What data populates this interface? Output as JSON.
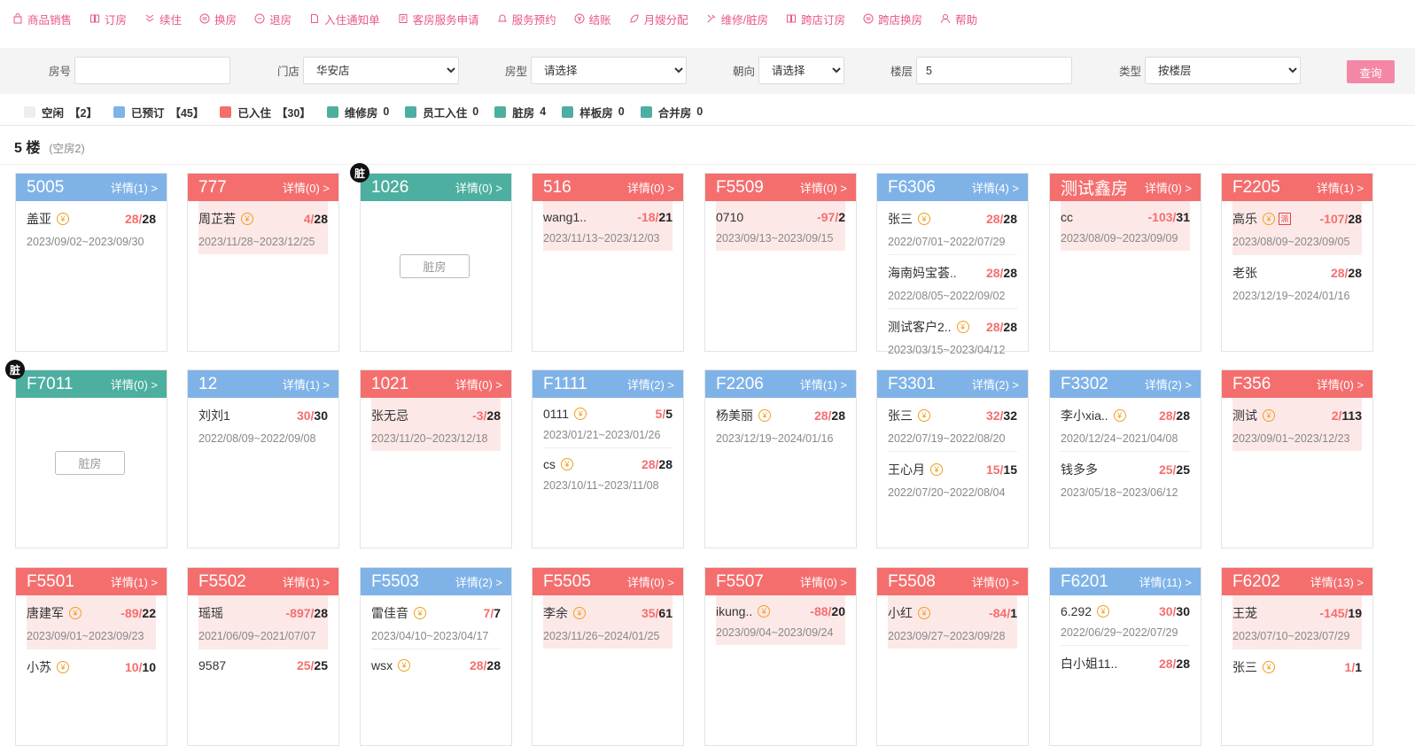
{
  "toolbar": [
    {
      "label": "商品销售",
      "icon": "bag-icon"
    },
    {
      "label": "订房",
      "icon": "book-icon"
    },
    {
      "label": "续住",
      "icon": "chevrons-down-icon"
    },
    {
      "label": "换房",
      "icon": "circle-swap-icon"
    },
    {
      "label": "退房",
      "icon": "circle-exit-icon"
    },
    {
      "label": "入住通知单",
      "icon": "document-icon"
    },
    {
      "label": "客房服务申请",
      "icon": "form-icon"
    },
    {
      "label": "服务预约",
      "icon": "bell-icon"
    },
    {
      "label": "结账",
      "icon": "coin-icon"
    },
    {
      "label": "月嫂分配",
      "icon": "leaf-icon"
    },
    {
      "label": "维修/脏房",
      "icon": "tools-icon"
    },
    {
      "label": "跨店订房",
      "icon": "book-icon"
    },
    {
      "label": "跨店换房",
      "icon": "circle-swap-icon"
    },
    {
      "label": "帮助",
      "icon": "user-icon"
    }
  ],
  "filters": {
    "room_no": {
      "label": "房号",
      "value": ""
    },
    "store": {
      "label": "门店",
      "value": "华安店"
    },
    "room_type": {
      "label": "房型",
      "value": "请选择"
    },
    "orientation": {
      "label": "朝向",
      "value": "请选择"
    },
    "floor": {
      "label": "楼层",
      "value": "5"
    },
    "type": {
      "label": "类型",
      "value": "按楼层"
    },
    "query_label": "查询"
  },
  "legend": [
    {
      "label": "空闲",
      "count": "【2】",
      "color": "#eeeeee"
    },
    {
      "label": "已预订",
      "count": "【45】",
      "color": "#7fb3e8"
    },
    {
      "label": "已入住",
      "count": "【30】",
      "color": "#f56e6e"
    },
    {
      "label": "维修房",
      "count": "0",
      "color": "#4daf9f"
    },
    {
      "label": "员工入住",
      "count": "0",
      "color": "#4daf9f"
    },
    {
      "label": "脏房",
      "count": "4",
      "color": "#4daf9f"
    },
    {
      "label": "样板房",
      "count": "0",
      "color": "#4daf9f"
    },
    {
      "label": "合并房",
      "count": "0",
      "color": "#4daf9f"
    }
  ],
  "floor": {
    "label": "5 楼",
    "empty": "(空房2)"
  },
  "dirty_label": "脏房",
  "dirty_badge": "脏",
  "rooms": [
    {
      "no": "5005",
      "detail": "详情(1) >",
      "status": "blue",
      "guests": [
        {
          "name": "盖亚",
          "yen": true,
          "a": "28",
          "b": "28",
          "dates": "2023/09/02~2023/09/30",
          "pink": false
        }
      ]
    },
    {
      "no": "777",
      "detail": "详情(0) >",
      "status": "red",
      "guests": [
        {
          "name": "周芷若",
          "yen": true,
          "a": "4",
          "b": "28",
          "dates": "2023/11/28~2023/12/25",
          "pink": true
        }
      ]
    },
    {
      "no": "1026",
      "detail": "详情(0) >",
      "status": "teal",
      "dirty": true,
      "guests": []
    },
    {
      "no": "516",
      "detail": "详情(0) >",
      "status": "red",
      "guests": [
        {
          "name": "wang1..",
          "yen": false,
          "a": "-18",
          "b": "21",
          "dates": "2023/11/13~2023/12/03",
          "pink": true
        }
      ]
    },
    {
      "no": "F5509",
      "detail": "详情(0) >",
      "status": "red",
      "guests": [
        {
          "name": "0710",
          "yen": false,
          "a": "-97",
          "b": "2",
          "dates": "2023/09/13~2023/09/15",
          "pink": true
        }
      ]
    },
    {
      "no": "F6306",
      "detail": "详情(4) >",
      "status": "blue",
      "guests": [
        {
          "name": "张三",
          "yen": true,
          "a": "28",
          "b": "28",
          "dates": "2022/07/01~2022/07/29",
          "pink": false
        },
        {
          "name": "海南妈宝荟..",
          "yen": false,
          "a": "28",
          "b": "28",
          "dates": "2022/08/05~2022/09/02",
          "pink": false
        },
        {
          "name": "测试客户2..",
          "yen": true,
          "a": "28",
          "b": "28",
          "dates": "2023/03/15~2023/04/12",
          "pink": false
        }
      ]
    },
    {
      "no": "测试鑫房",
      "detail": "详情(0) >",
      "status": "red",
      "guests": [
        {
          "name": "cc",
          "yen": false,
          "a": "-103",
          "b": "31",
          "dates": "2023/08/09~2023/09/09",
          "pink": true
        }
      ]
    },
    {
      "no": "F2205",
      "detail": "详情(1) >",
      "status": "red",
      "guests": [
        {
          "name": "高乐",
          "yen": true,
          "pai": "派",
          "a": "-107",
          "b": "28",
          "dates": "2023/08/09~2023/09/05",
          "pink": true
        },
        {
          "name": "老张",
          "yen": false,
          "a": "28",
          "b": "28",
          "dates": "2023/12/19~2024/01/16",
          "pink": false
        }
      ]
    },
    {
      "no": "F7011",
      "detail": "详情(0) >",
      "status": "teal",
      "dirty": true,
      "guests": []
    },
    {
      "no": "12",
      "detail": "详情(1) >",
      "status": "blue",
      "guests": [
        {
          "name": "刘刘1",
          "yen": false,
          "a": "30",
          "b": "30",
          "dates": "2022/08/09~2022/09/08",
          "pink": false
        }
      ]
    },
    {
      "no": "1021",
      "detail": "详情(0) >",
      "status": "red",
      "guests": [
        {
          "name": "张无忌",
          "yen": false,
          "a": "-3",
          "b": "28",
          "dates": "2023/11/20~2023/12/18",
          "pink": true
        }
      ]
    },
    {
      "no": "F1111",
      "detail": "详情(2) >",
      "status": "blue",
      "guests": [
        {
          "name": "0111",
          "yen": true,
          "a": "5",
          "b": "5",
          "dates": "2023/01/21~2023/01/26",
          "pink": false
        },
        {
          "name": "cs",
          "yen": true,
          "a": "28",
          "b": "28",
          "dates": "2023/10/11~2023/11/08",
          "pink": false
        }
      ]
    },
    {
      "no": "F2206",
      "detail": "详情(1) >",
      "status": "blue",
      "guests": [
        {
          "name": "杨美丽",
          "yen": true,
          "a": "28",
          "b": "28",
          "dates": "2023/12/19~2024/01/16",
          "pink": false
        }
      ]
    },
    {
      "no": "F3301",
      "detail": "详情(2) >",
      "status": "blue",
      "guests": [
        {
          "name": "张三",
          "yen": true,
          "a": "32",
          "b": "32",
          "dates": "2022/07/19~2022/08/20",
          "pink": false
        },
        {
          "name": "王心月",
          "yen": true,
          "a": "15",
          "b": "15",
          "dates": "2022/07/20~2022/08/04",
          "pink": false
        }
      ]
    },
    {
      "no": "F3302",
      "detail": "详情(2) >",
      "status": "blue",
      "guests": [
        {
          "name": "李小xia..",
          "yen": true,
          "a": "28",
          "b": "28",
          "dates": "2020/12/24~2021/04/08",
          "pink": false
        },
        {
          "name": "钱多多",
          "yen": false,
          "a": "25",
          "b": "25",
          "dates": "2023/05/18~2023/06/12",
          "pink": false
        }
      ]
    },
    {
      "no": "F356",
      "detail": "详情(0) >",
      "status": "red",
      "guests": [
        {
          "name": "测试",
          "yen": true,
          "a": "2",
          "b": "113",
          "dates": "2023/09/01~2023/12/23",
          "pink": true
        }
      ]
    },
    {
      "no": "F5501",
      "detail": "详情(1) >",
      "status": "red",
      "guests": [
        {
          "name": "唐建军",
          "yen": true,
          "a": "-89",
          "b": "22",
          "dates": "2023/09/01~2023/09/23",
          "pink": true
        },
        {
          "name": "小苏",
          "yen": true,
          "a": "10",
          "b": "10",
          "dates": "",
          "pink": false
        }
      ]
    },
    {
      "no": "F5502",
      "detail": "详情(1) >",
      "status": "red",
      "guests": [
        {
          "name": "瑶瑶",
          "yen": false,
          "a": "-897",
          "b": "28",
          "dates": "2021/06/09~2021/07/07",
          "pink": true
        },
        {
          "name": "9587",
          "yen": false,
          "a": "25",
          "b": "25",
          "dates": "",
          "pink": false
        }
      ]
    },
    {
      "no": "F5503",
      "detail": "详情(2) >",
      "status": "blue",
      "guests": [
        {
          "name": "雷佳音",
          "yen": true,
          "a": "7",
          "b": "7",
          "dates": "2023/04/10~2023/04/17",
          "pink": false
        },
        {
          "name": "wsx",
          "yen": true,
          "a": "28",
          "b": "28",
          "dates": "",
          "pink": false
        }
      ]
    },
    {
      "no": "F5505",
      "detail": "详情(0) >",
      "status": "red",
      "guests": [
        {
          "name": "李余",
          "yen": true,
          "a": "35",
          "b": "61",
          "dates": "2023/11/26~2024/01/25",
          "pink": true
        }
      ]
    },
    {
      "no": "F5507",
      "detail": "详情(0) >",
      "status": "red",
      "guests": [
        {
          "name": "ikung..",
          "yen": true,
          "a": "-88",
          "b": "20",
          "dates": "2023/09/04~2023/09/24",
          "pink": true
        }
      ]
    },
    {
      "no": "F5508",
      "detail": "详情(0) >",
      "status": "red",
      "guests": [
        {
          "name": "小红",
          "yen": true,
          "a": "-84",
          "b": "1",
          "dates": "2023/09/27~2023/09/28",
          "pink": true
        }
      ]
    },
    {
      "no": "F6201",
      "detail": "详情(11) >",
      "status": "blue",
      "guests": [
        {
          "name": "6.292",
          "yen": true,
          "a": "30",
          "b": "30",
          "dates": "2022/06/29~2022/07/29",
          "pink": false
        },
        {
          "name": "白小姐11..",
          "yen": false,
          "a": "28",
          "b": "28",
          "dates": "",
          "pink": false
        }
      ]
    },
    {
      "no": "F6202",
      "detail": "详情(13) >",
      "status": "red",
      "guests": [
        {
          "name": "王茏",
          "yen": false,
          "a": "-145",
          "b": "19",
          "dates": "2023/07/10~2023/07/29",
          "pink": true
        },
        {
          "name": "张三",
          "yen": true,
          "a": "1",
          "b": "1",
          "dates": "",
          "pink": false
        }
      ]
    }
  ]
}
